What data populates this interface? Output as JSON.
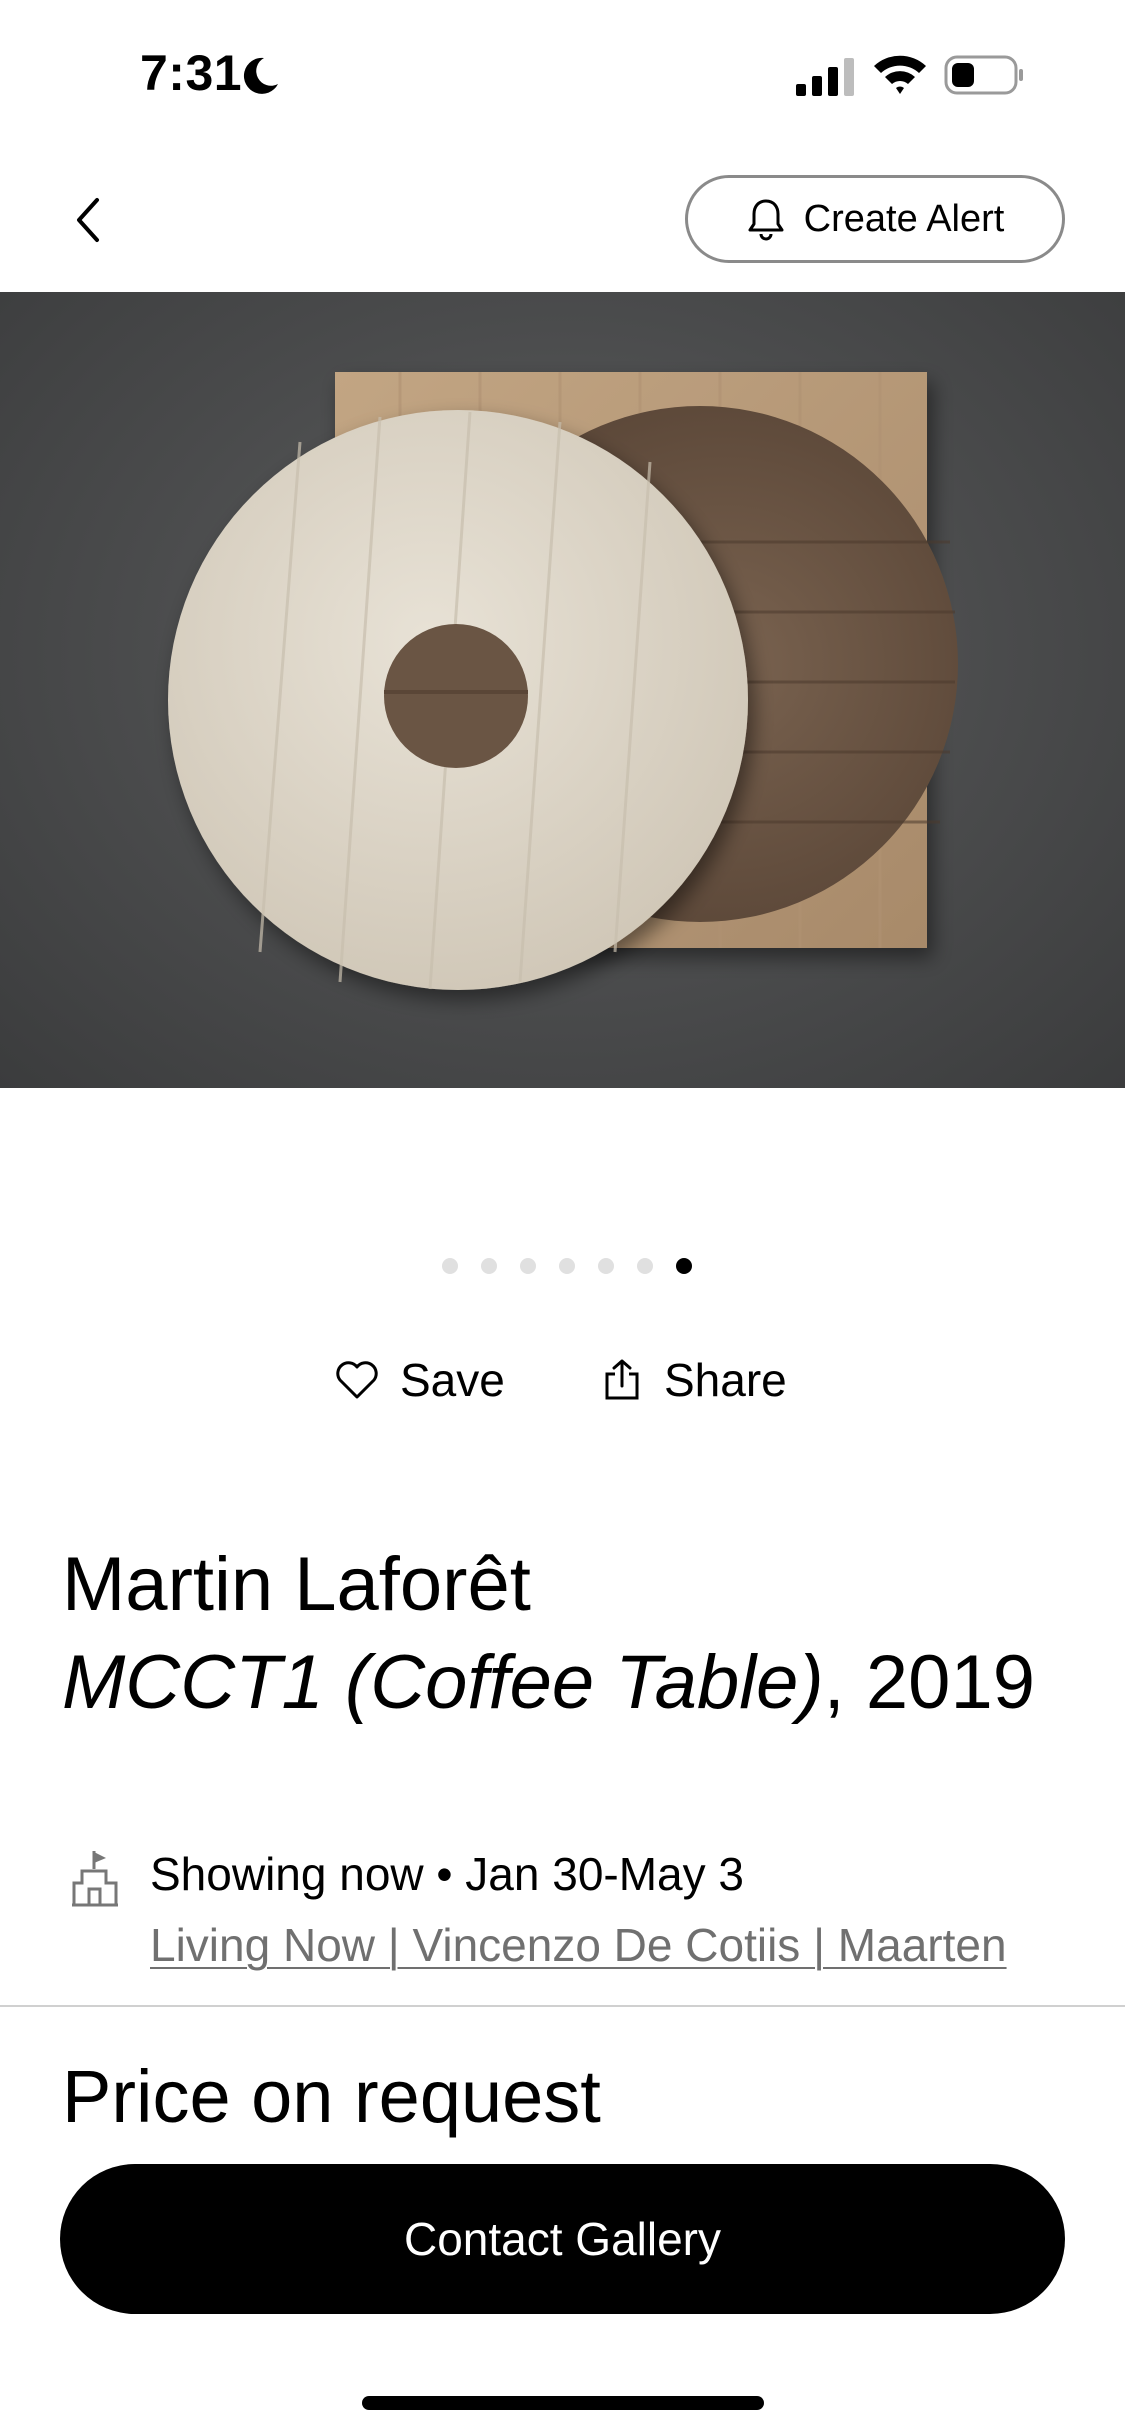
{
  "status_bar": {
    "time": "7:31"
  },
  "nav": {
    "create_alert_label": "Create Alert"
  },
  "gallery": {
    "image_count": 7,
    "active_index": 6
  },
  "actions": {
    "save_label": "Save",
    "share_label": "Share"
  },
  "artwork": {
    "artist": "Martin Laforêt",
    "title": "MCCT1 (Coffee Table)",
    "year_suffix": ", 2019"
  },
  "show": {
    "status": "Showing now • Jan 30-May 3",
    "link": "Living Now | Vincenzo De Cotiis | Maarten"
  },
  "purchase": {
    "price": "Price on request",
    "contact_label": "Contact Gallery"
  },
  "colors": {
    "accent": "#000000",
    "link": "#707070",
    "background": "#ffffff"
  }
}
